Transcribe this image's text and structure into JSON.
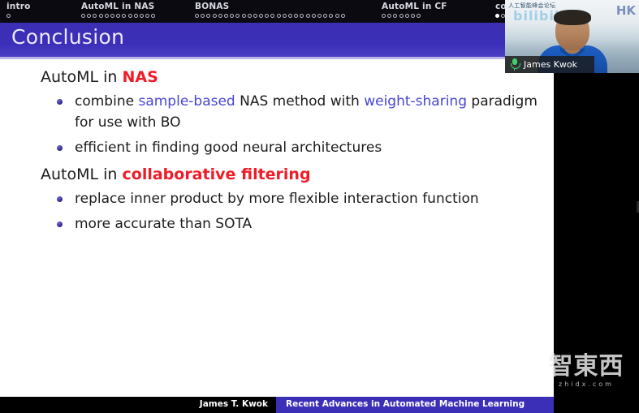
{
  "slide": {
    "nav_sections": [
      {
        "label": "intro",
        "dots": 1,
        "current": false
      },
      {
        "label": "AutoML in NAS",
        "dots": 13,
        "current": false
      },
      {
        "label": "BONAS",
        "dots": 26,
        "current": false
      },
      {
        "label": "AutoML in CF",
        "dots": 7,
        "current": false
      },
      {
        "label": "co",
        "dots": 2,
        "current": true
      }
    ],
    "title": "Conclusion",
    "blocks": [
      {
        "heading_parts": [
          {
            "text": "AutoML in ",
            "style": "plain"
          },
          {
            "text": "NAS",
            "style": "red"
          }
        ],
        "bullets": [
          {
            "parts": [
              {
                "text": "combine ",
                "style": "plain"
              },
              {
                "text": "sample-based",
                "style": "blue"
              },
              {
                "text": " NAS method with ",
                "style": "plain"
              },
              {
                "text": "weight-sharing",
                "style": "blue"
              },
              {
                "text": " paradigm for use with BO",
                "style": "plain"
              }
            ]
          },
          {
            "parts": [
              {
                "text": "efficient in finding good neural architectures",
                "style": "plain"
              }
            ]
          }
        ]
      },
      {
        "heading_parts": [
          {
            "text": "AutoML in ",
            "style": "plain"
          },
          {
            "text": "collaborative filtering",
            "style": "red"
          }
        ],
        "bullets": [
          {
            "parts": [
              {
                "text": "replace inner product by more flexible interaction function",
                "style": "plain"
              }
            ]
          },
          {
            "parts": [
              {
                "text": "more accurate than SOTA",
                "style": "plain"
              }
            ]
          }
        ]
      }
    ],
    "footer": {
      "author": "James T. Kwok",
      "talk_title": "Recent Advances in Automated Machine Learning"
    }
  },
  "webcam": {
    "participant_name": "James Kwok",
    "mic_icon": "microphone-icon",
    "mic_color": "#41d16a",
    "background_banner_text": "人工智能峰会论坛",
    "background_watermark": "bilibili",
    "background_logo": "HK"
  },
  "watermark": {
    "glyphs": "智東西",
    "url": "zhidx.com"
  },
  "colors": {
    "title_band": "#3b2fb8",
    "accent_red": "#ef1c28",
    "accent_blue": "#4846d6",
    "bullet": "#2a1f86",
    "footer_band": "#3b2fb8"
  }
}
